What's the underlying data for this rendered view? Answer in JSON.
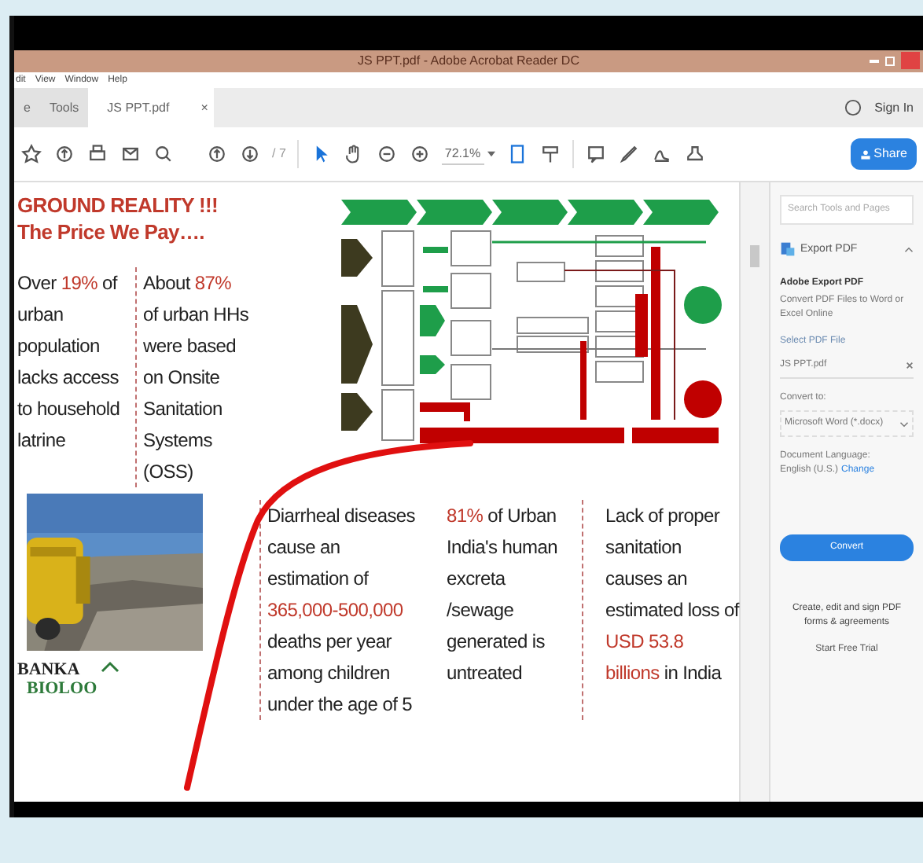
{
  "window": {
    "title": "JS PPT.pdf - Adobe Acrobat Reader DC"
  },
  "menu": [
    "dit",
    "View",
    "Window",
    "Help"
  ],
  "tabs": [
    {
      "label": "e",
      "selected": false
    },
    {
      "label": "Tools",
      "selected": false
    },
    {
      "label": "JS PPT.pdf",
      "selected": true,
      "close": "×"
    }
  ],
  "account": {
    "label": "Sign In"
  },
  "toolbar": {
    "page_total": "/ 7",
    "zoom": "72.1%",
    "tools": [
      {
        "kind": "select",
        "selected": true
      },
      {
        "kind": "hand",
        "selected": false
      }
    ],
    "share": "Share"
  },
  "slide": {
    "heading": [
      "GROUND REALITY !!!",
      "The Price We Pay…."
    ],
    "facts": [
      [
        {
          "t": "Over "
        },
        {
          "t": "19%",
          "hl": true
        },
        {
          "t": " of urban population lacks access to household latrine"
        }
      ],
      [
        {
          "t": "About "
        },
        {
          "t": "87%",
          "hl": true
        },
        {
          "t": " of urban HHs were based on Onsite Sanitation Systems (OSS)"
        }
      ],
      [
        {
          "t": "Diarrheal diseases cause an estimation of "
        },
        {
          "t": "365,000-500,000",
          "hl": true
        },
        {
          "t": " deaths per year among children under the age of 5"
        }
      ],
      [
        {
          "t": "81%",
          "hl": true
        },
        {
          "t": " of Urban India's human excreta /sewage generated is untreated"
        }
      ],
      [
        {
          "t": "Lack of proper sanitation causes an estimated loss of "
        },
        {
          "t": "USD 53.8 billions",
          "hl": true
        },
        {
          "t": " in India"
        }
      ]
    ],
    "photo": {
      "kind": "picture"
    },
    "logo": [
      "BANKA",
      "BIOLOO"
    ]
  },
  "panel": {
    "search": {
      "placeholder": "Search Tools and Pages"
    },
    "tool": "Export PDF",
    "title": "Adobe Export PDF",
    "description": "Convert PDF Files to Word or Excel Online",
    "file_label": "Select PDF File",
    "file": "JS PPT.pdf",
    "convert_label": "Convert to:",
    "format": "Microsoft Word (*.docx)",
    "language_label": "Document Language:",
    "language": "English (U.S.)",
    "change": "Change",
    "convert": "Convert",
    "promo": "Create, edit and sign PDF forms & agreements",
    "trial": "Start Free Trial"
  }
}
